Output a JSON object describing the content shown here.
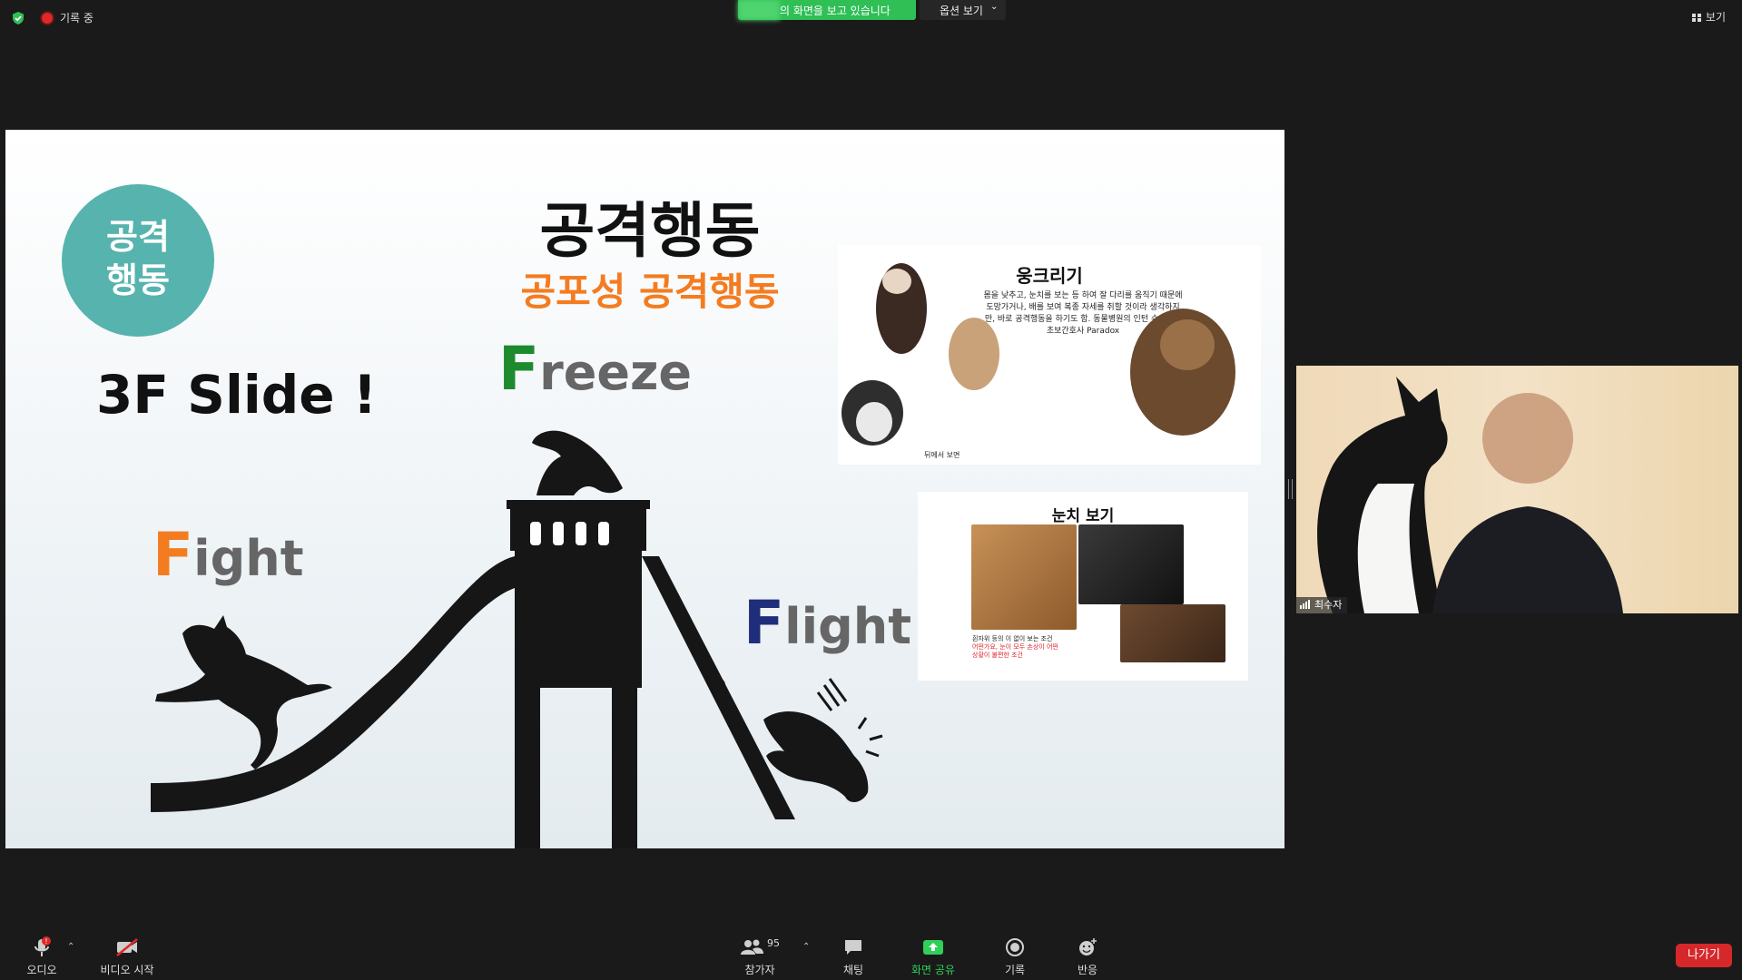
{
  "top_bar": {
    "recording_label": "기록 중",
    "share_banner_text": "의 화면을 보고 있습니다",
    "options_label": "옵션 보기",
    "view_label": "보기"
  },
  "slide": {
    "circle_text_line1": "공격",
    "circle_text_line2": "행동",
    "title": "공격행동",
    "subtitle": "공포성 공격행동",
    "slide_label": "3F Slide !",
    "freeze_cap": "F",
    "freeze_rest": "reeze",
    "fight_cap": "F",
    "fight_rest": "ight",
    "flight_cap": "F",
    "flight_rest": "light",
    "crouch_card": {
      "title": "웅크리기",
      "desc": "몸을 낮추고, 눈치를 보는 등 하여 잘 다리를 움직기 때문에 도망가거나, 배를 보여 복종 자세를 취할 것이라 생각하지만, 바로 공격행동을 하기도 함. 동물병원의 인턴 수의사와 초보간호사 Paradox",
      "note": "뒤에서 보면"
    },
    "eye_card": {
      "title": "눈치 보기",
      "note_line1": "흰자위 등의 이 없이 보는 조건",
      "note_line2": "어떤가요, 눈이 모두 손상이 어떤",
      "note_line3": "상황이 불편한 조건"
    },
    "colors": {
      "circle": "#56b3ad",
      "subtitle": "#f47c20",
      "freeze_F": "#1e8a2e",
      "fight_F": "#f47c20",
      "flight_F": "#1f2e7a"
    }
  },
  "video": {
    "participant_name": "최수자"
  },
  "toolbar": {
    "audio_label": "오디오",
    "audio_badge": "!",
    "video_label": "비디오 시작",
    "participants_label": "참가자",
    "participants_count": "95",
    "chat_label": "채팅",
    "share_label": "화면 공유",
    "record_label": "기록",
    "reactions_label": "반응",
    "leave_label": "나가기"
  }
}
